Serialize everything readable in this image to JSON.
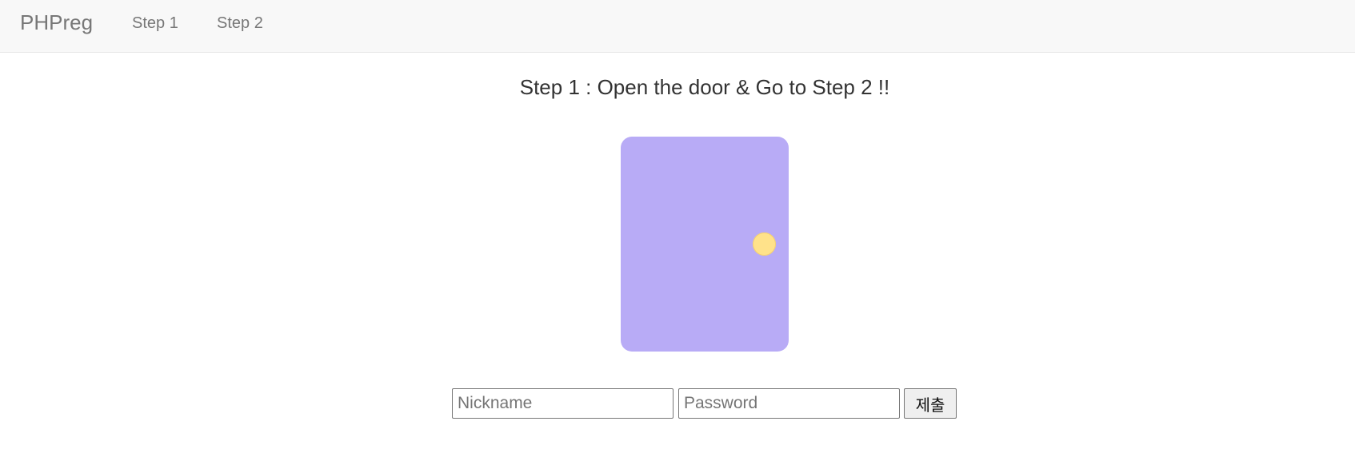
{
  "navbar": {
    "brand": "PHPreg",
    "links": [
      {
        "label": "Step 1"
      },
      {
        "label": "Step 2"
      }
    ]
  },
  "main": {
    "title": "Step 1 : Open the door & Go to Step 2 !!",
    "door": {
      "color": "#b8abf6",
      "knob_color": "#ffe28a"
    },
    "form": {
      "nickname_placeholder": "Nickname",
      "password_placeholder": "Password",
      "submit_label": "제출"
    }
  }
}
